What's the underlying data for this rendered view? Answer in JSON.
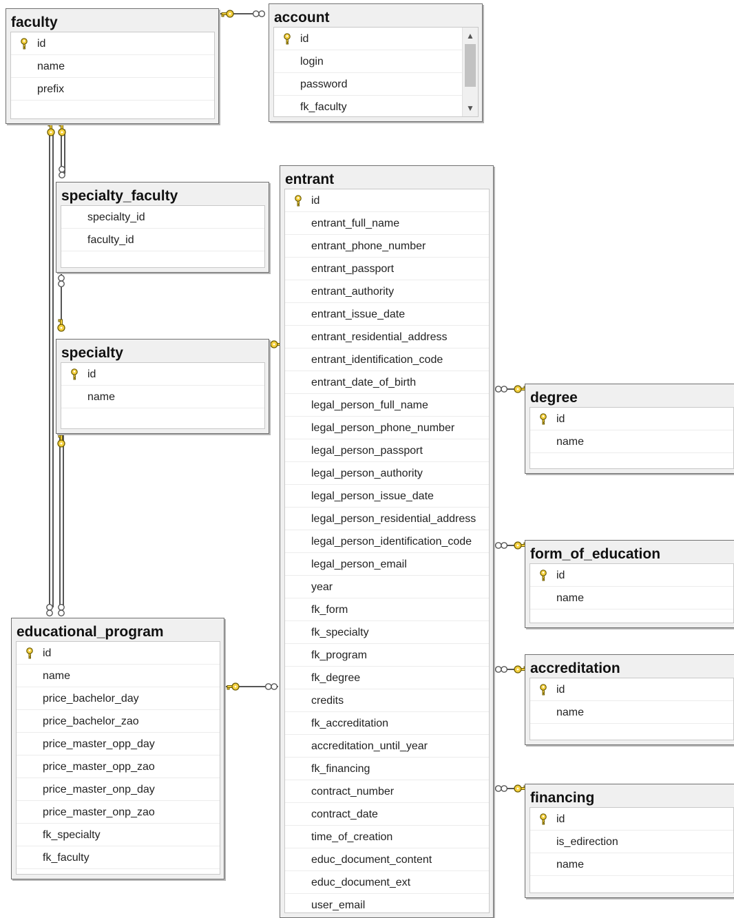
{
  "colors": {
    "key_fill": "#f4d03f",
    "key_stroke": "#6b5a00",
    "line": "#555555",
    "body": "#ffffff",
    "header": "#f0f0f0"
  },
  "icons": {
    "primary_key": "key-icon",
    "scroll_up": "chevron-up-icon",
    "scroll_down": "chevron-down-icon"
  },
  "tables": [
    {
      "id": "faculty",
      "title": "faculty",
      "columns": [
        {
          "name": "id",
          "pk": true
        },
        {
          "name": "name"
        },
        {
          "name": "prefix"
        }
      ]
    },
    {
      "id": "account",
      "title": "account",
      "scroll": true,
      "columns": [
        {
          "name": "id",
          "pk": true
        },
        {
          "name": "login"
        },
        {
          "name": "password"
        },
        {
          "name": "fk_faculty"
        }
      ]
    },
    {
      "id": "specialty_faculty",
      "title": "specialty_faculty",
      "columns": [
        {
          "name": "specialty_id"
        },
        {
          "name": "faculty_id"
        }
      ]
    },
    {
      "id": "specialty",
      "title": "specialty",
      "columns": [
        {
          "name": "id",
          "pk": true
        },
        {
          "name": "name"
        }
      ]
    },
    {
      "id": "entrant",
      "title": "entrant",
      "columns": [
        {
          "name": "id",
          "pk": true
        },
        {
          "name": "entrant_full_name"
        },
        {
          "name": "entrant_phone_number"
        },
        {
          "name": "entrant_passport"
        },
        {
          "name": "entrant_authority"
        },
        {
          "name": "entrant_issue_date"
        },
        {
          "name": "entrant_residential_address"
        },
        {
          "name": "entrant_identification_code"
        },
        {
          "name": "entrant_date_of_birth"
        },
        {
          "name": "legal_person_full_name"
        },
        {
          "name": "legal_person_phone_number"
        },
        {
          "name": "legal_person_passport"
        },
        {
          "name": "legal_person_authority"
        },
        {
          "name": "legal_person_issue_date"
        },
        {
          "name": "legal_person_residential_address"
        },
        {
          "name": "legal_person_identification_code"
        },
        {
          "name": "legal_person_email"
        },
        {
          "name": "year"
        },
        {
          "name": "fk_form"
        },
        {
          "name": "fk_specialty"
        },
        {
          "name": "fk_program"
        },
        {
          "name": "fk_degree"
        },
        {
          "name": "credits"
        },
        {
          "name": "fk_accreditation"
        },
        {
          "name": "accreditation_until_year"
        },
        {
          "name": "fk_financing"
        },
        {
          "name": "contract_number"
        },
        {
          "name": "contract_date"
        },
        {
          "name": "time_of_creation"
        },
        {
          "name": "educ_document_content"
        },
        {
          "name": "educ_document_ext"
        },
        {
          "name": "user_email"
        }
      ]
    },
    {
      "id": "degree",
      "title": "degree",
      "columns": [
        {
          "name": "id",
          "pk": true
        },
        {
          "name": "name"
        }
      ]
    },
    {
      "id": "form_of_education",
      "title": "form_of_education",
      "columns": [
        {
          "name": "id",
          "pk": true
        },
        {
          "name": "name"
        }
      ]
    },
    {
      "id": "accreditation",
      "title": "accreditation",
      "columns": [
        {
          "name": "id",
          "pk": true
        },
        {
          "name": "name"
        }
      ]
    },
    {
      "id": "financing",
      "title": "financing",
      "columns": [
        {
          "name": "id",
          "pk": true
        },
        {
          "name": "is_edirection"
        },
        {
          "name": "name"
        }
      ]
    },
    {
      "id": "educational_program",
      "title": "educational_program",
      "columns": [
        {
          "name": "id",
          "pk": true
        },
        {
          "name": "name"
        },
        {
          "name": "price_bachelor_day"
        },
        {
          "name": "price_bachelor_zao"
        },
        {
          "name": "price_master_opp_day"
        },
        {
          "name": "price_master_opp_zao"
        },
        {
          "name": "price_master_onp_day"
        },
        {
          "name": "price_master_onp_zao"
        },
        {
          "name": "fk_specialty"
        },
        {
          "name": "fk_faculty"
        }
      ]
    }
  ],
  "relationships": [
    {
      "one": "faculty",
      "many": "account"
    },
    {
      "one": "faculty",
      "many": "educational_program"
    },
    {
      "one": "faculty",
      "many": "specialty_faculty"
    },
    {
      "one": "specialty",
      "many": "specialty_faculty"
    },
    {
      "one": "specialty",
      "many": "educational_program"
    },
    {
      "one": "specialty",
      "many": "entrant"
    },
    {
      "one": "educational_program",
      "many": "entrant"
    },
    {
      "one": "degree",
      "many": "entrant"
    },
    {
      "one": "form_of_education",
      "many": "entrant"
    },
    {
      "one": "accreditation",
      "many": "entrant"
    },
    {
      "one": "financing",
      "many": "entrant"
    }
  ]
}
